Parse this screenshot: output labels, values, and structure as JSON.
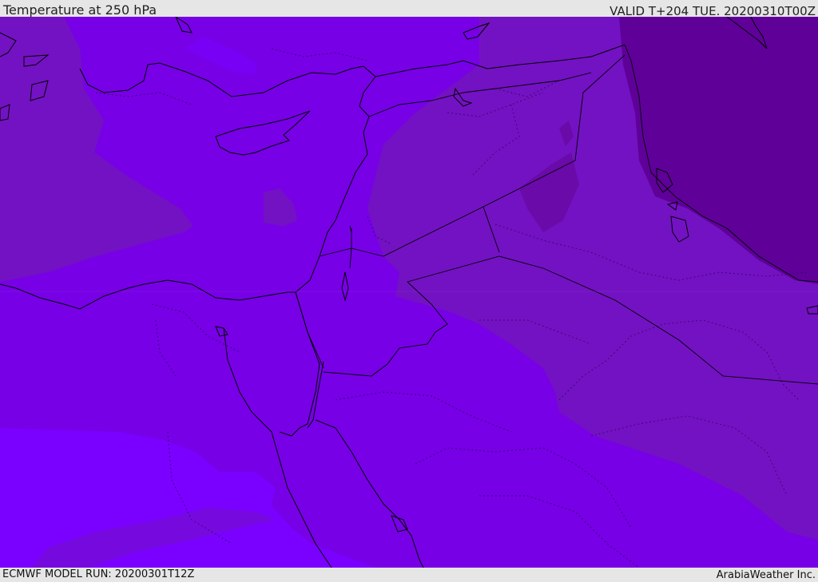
{
  "header": {
    "title": "Temperature at 250 hPa",
    "valid_time": "VALID T+204 TUE. 20200310T00Z"
  },
  "footer": {
    "model_run": "ECMWF MODEL RUN: 20200301T12Z",
    "credit": "ArabiaWeather Inc."
  },
  "colors": {
    "band_warmest": "#7a00ff",
    "band_warm": "#7700e6",
    "band_mid": "#7312c2",
    "band_cool": "#6a0aa8",
    "band_coldest": "#5f0099",
    "coastline": "#000000",
    "border": "#000000"
  }
}
